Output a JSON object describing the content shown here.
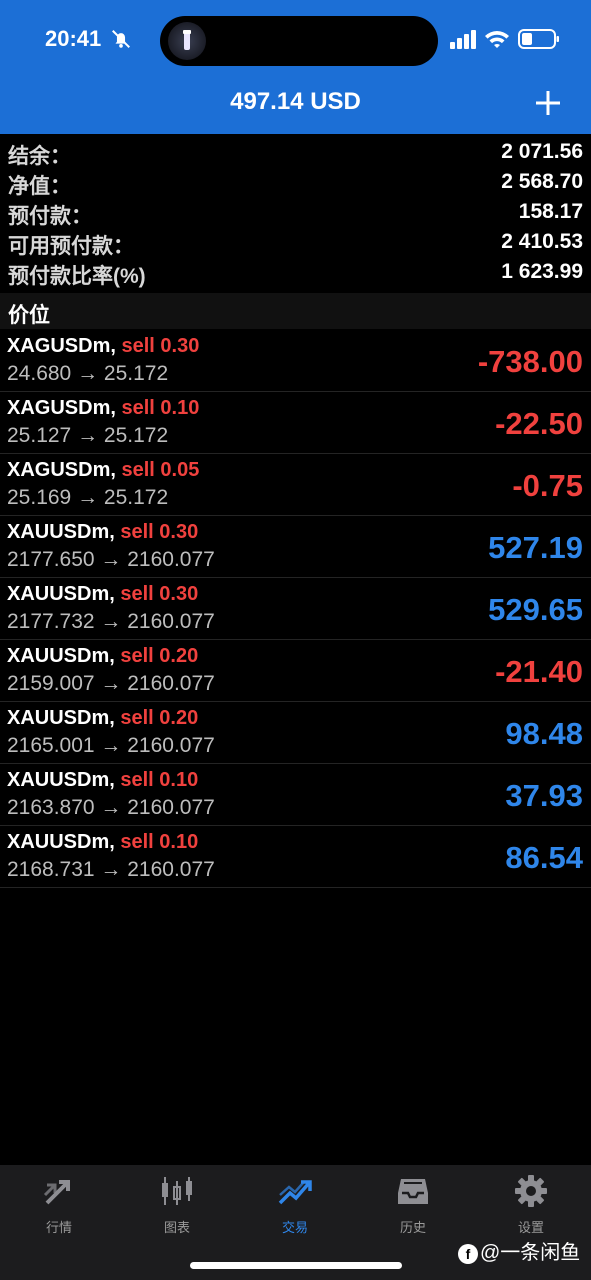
{
  "status_bar": {
    "time": "20:41"
  },
  "header": {
    "title": "497.14 USD"
  },
  "summary": [
    {
      "label": "结余：",
      "value": "2 071.56"
    },
    {
      "label": "净值：",
      "value": "2 568.70"
    },
    {
      "label": "预付款：",
      "value": "158.17"
    },
    {
      "label": "可用预付款：",
      "value": "2 410.53"
    },
    {
      "label": "预付款比率(%)",
      "value": "1 623.99"
    }
  ],
  "section": {
    "title": "价位"
  },
  "positions": [
    {
      "symbol": "XAGUSDm,",
      "side": "sell 0.30",
      "prices": "24.680 → 25.172",
      "profit": "-738.00"
    },
    {
      "symbol": "XAGUSDm,",
      "side": "sell 0.10",
      "prices": "25.127 → 25.172",
      "profit": "-22.50"
    },
    {
      "symbol": "XAGUSDm,",
      "side": "sell 0.05",
      "prices": "25.169 → 25.172",
      "profit": "-0.75"
    },
    {
      "symbol": "XAUUSDm,",
      "side": "sell 0.30",
      "prices": "2177.650 → 2160.077",
      "profit": "527.19"
    },
    {
      "symbol": "XAUUSDm,",
      "side": "sell 0.30",
      "prices": "2177.732 → 2160.077",
      "profit": "529.65"
    },
    {
      "symbol": "XAUUSDm,",
      "side": "sell 0.20",
      "prices": "2159.007 → 2160.077",
      "profit": "-21.40"
    },
    {
      "symbol": "XAUUSDm,",
      "side": "sell 0.20",
      "prices": "2165.001 → 2160.077",
      "profit": "98.48"
    },
    {
      "symbol": "XAUUSDm,",
      "side": "sell 0.10",
      "prices": "2163.870 → 2160.077",
      "profit": "37.93"
    },
    {
      "symbol": "XAUUSDm,",
      "side": "sell 0.10",
      "prices": "2168.731 → 2160.077",
      "profit": "86.54"
    }
  ],
  "tabs": [
    {
      "label": "行情",
      "icon": "quotes-arrows-icon"
    },
    {
      "label": "图表",
      "icon": "candlestick-chart-icon"
    },
    {
      "label": "交易",
      "icon": "trade-chart-icon",
      "active": true
    },
    {
      "label": "历史",
      "icon": "history-inbox-icon"
    },
    {
      "label": "设置",
      "icon": "gear-icon"
    }
  ],
  "watermark": {
    "text": "@一条闲鱼"
  },
  "colors": {
    "header_blue": "#1c6fd6",
    "loss_red": "#f0413e",
    "profit_blue": "#2f86ea"
  }
}
